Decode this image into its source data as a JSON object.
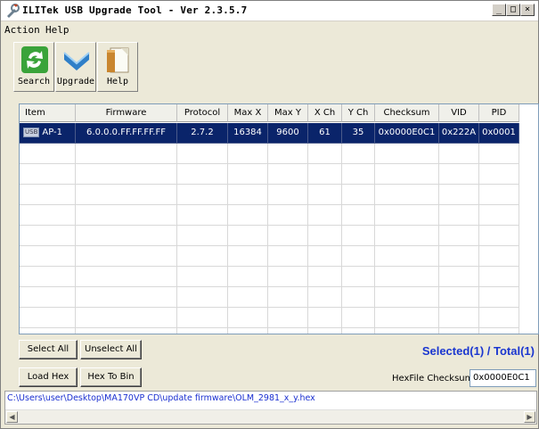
{
  "window": {
    "title": "ILITek USB Upgrade Tool - Ver 2.3.5.7",
    "min_label": "_",
    "max_label": "□",
    "close_label": "×"
  },
  "menu": {
    "action": "Action",
    "help": "Help"
  },
  "toolbar": {
    "search": "Search",
    "upgrade": "Upgrade",
    "help": "Help"
  },
  "table": {
    "columns": [
      "Item",
      "Firmware",
      "Protocol",
      "Max X",
      "Max Y",
      "X Ch",
      "Y Ch",
      "Checksum",
      "VID",
      "PID"
    ],
    "rows": [
      {
        "usb_tag": "USB",
        "item": "AP-1",
        "firmware": "6.0.0.0.FF.FF.FF.FF",
        "protocol": "2.7.2",
        "max_x": "16384",
        "max_y": "9600",
        "x_ch": "61",
        "y_ch": "35",
        "checksum": "0x0000E0C1",
        "vid": "0x222A",
        "pid": "0x0001",
        "selected": true
      }
    ]
  },
  "buttons": {
    "select_all": "Select All",
    "unselect_all": "Unselect All",
    "load_hex": "Load Hex",
    "hex_to_bin": "Hex To Bin"
  },
  "status": {
    "selected_total": "Selected(1) / Total(1)",
    "hexfile_label": "HexFile Checksum(AP) :",
    "hexfile_value": "0x0000E0C1",
    "path": "C:\\Users\\user\\Desktop\\MA170VP  CD\\update firmware\\OLM_2981_x_y.hex"
  },
  "colors": {
    "selection": "#0a246a",
    "status_blue": "#1a36d0",
    "path_blue": "#1a2fd0"
  }
}
